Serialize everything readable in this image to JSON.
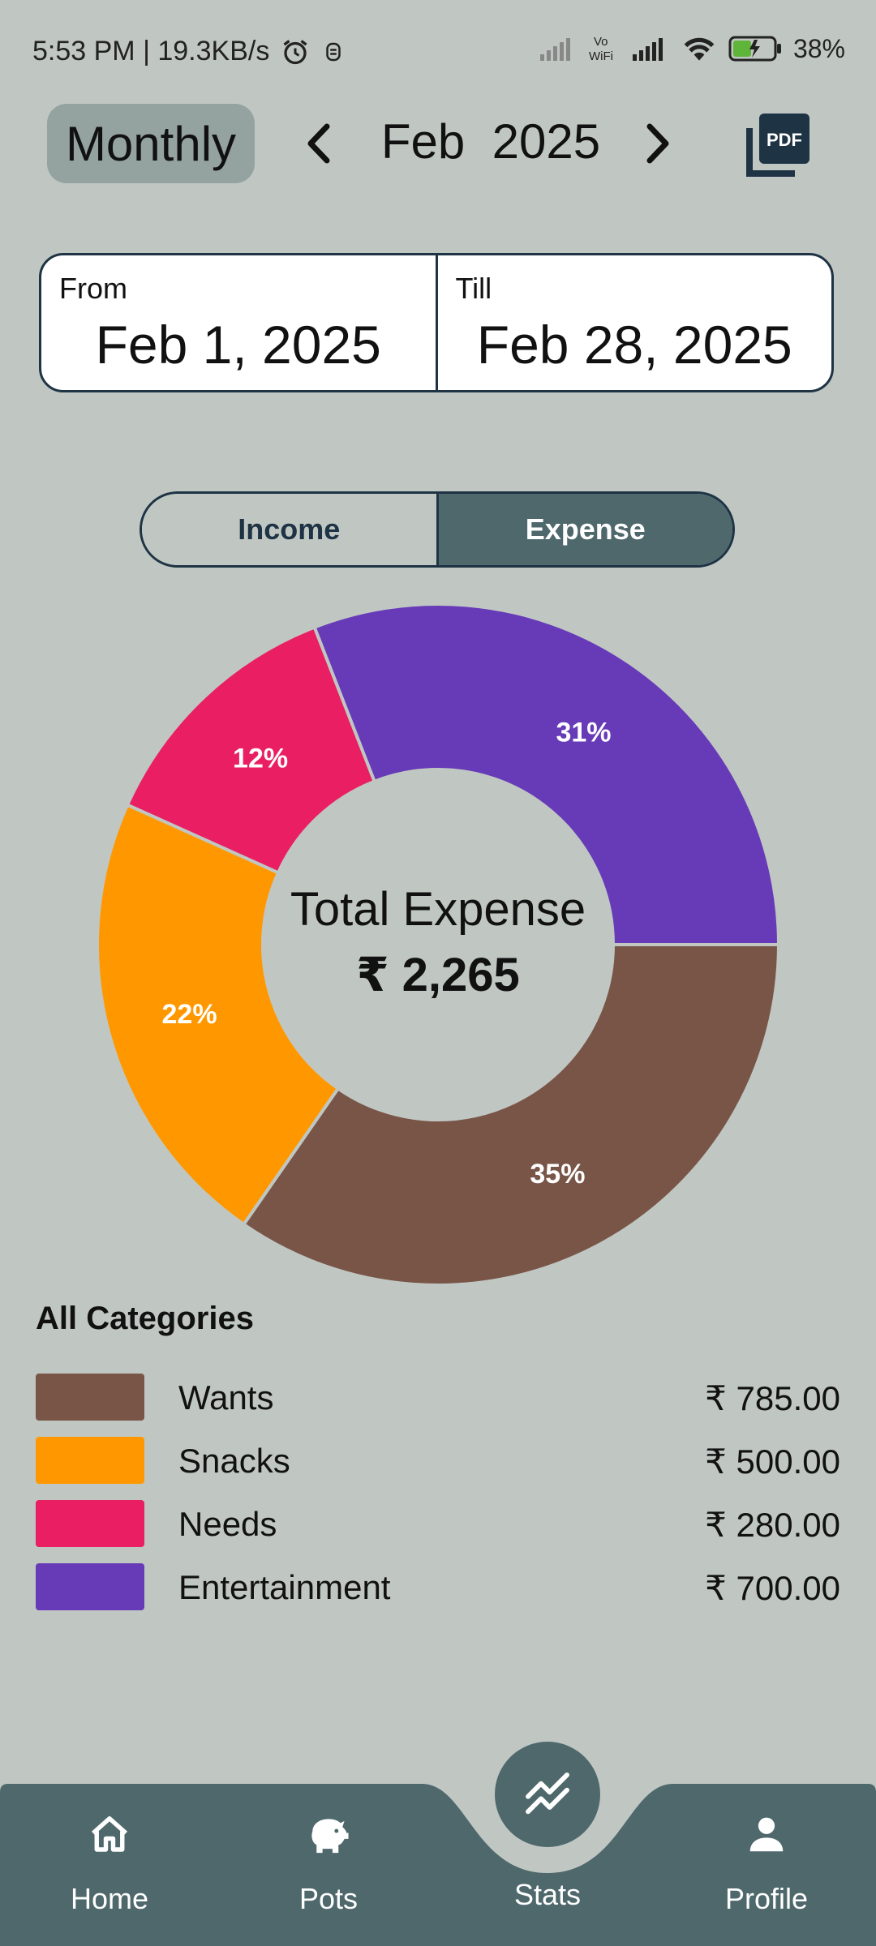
{
  "status_bar": {
    "time_speed": "5:53 PM | 19.3KB/s",
    "battery": "38%"
  },
  "header": {
    "period": "Monthly",
    "month": "Feb  2025",
    "prev_icon": "chevron-left-icon",
    "next_icon": "chevron-right-icon",
    "pdf_icon": "pdf-icon"
  },
  "range": {
    "from_label": "From",
    "from_value": "Feb 1, 2025",
    "till_label": "Till",
    "till_value": "Feb 28, 2025"
  },
  "toggle": {
    "income": "Income",
    "expense": "Expense",
    "selected": "Expense"
  },
  "chart_center": {
    "title": "Total Expense",
    "amount": "₹ 2,265"
  },
  "chart_data": {
    "type": "pie",
    "donut": true,
    "categories": [
      "Wants",
      "Snacks",
      "Needs",
      "Entertainment"
    ],
    "values": [
      785,
      500,
      280,
      700
    ],
    "labels": [
      "35%",
      "22%",
      "12%",
      "31%"
    ],
    "colors": [
      "#795548",
      "#ff9800",
      "#e91e63",
      "#673ab7"
    ]
  },
  "categories": {
    "heading": "All Categories",
    "items": [
      {
        "name": "Wants",
        "amount": "₹ 785.00",
        "color": "#795548"
      },
      {
        "name": "Snacks",
        "amount": "₹ 500.00",
        "color": "#ff9800"
      },
      {
        "name": "Needs",
        "amount": "₹ 280.00",
        "color": "#e91e63"
      },
      {
        "name": "Entertainment",
        "amount": "₹ 700.00",
        "color": "#673ab7"
      }
    ]
  },
  "bottom_nav": {
    "home": "Home",
    "pots": "Pots",
    "stats": "Stats",
    "profile": "Profile",
    "active": "Stats"
  }
}
